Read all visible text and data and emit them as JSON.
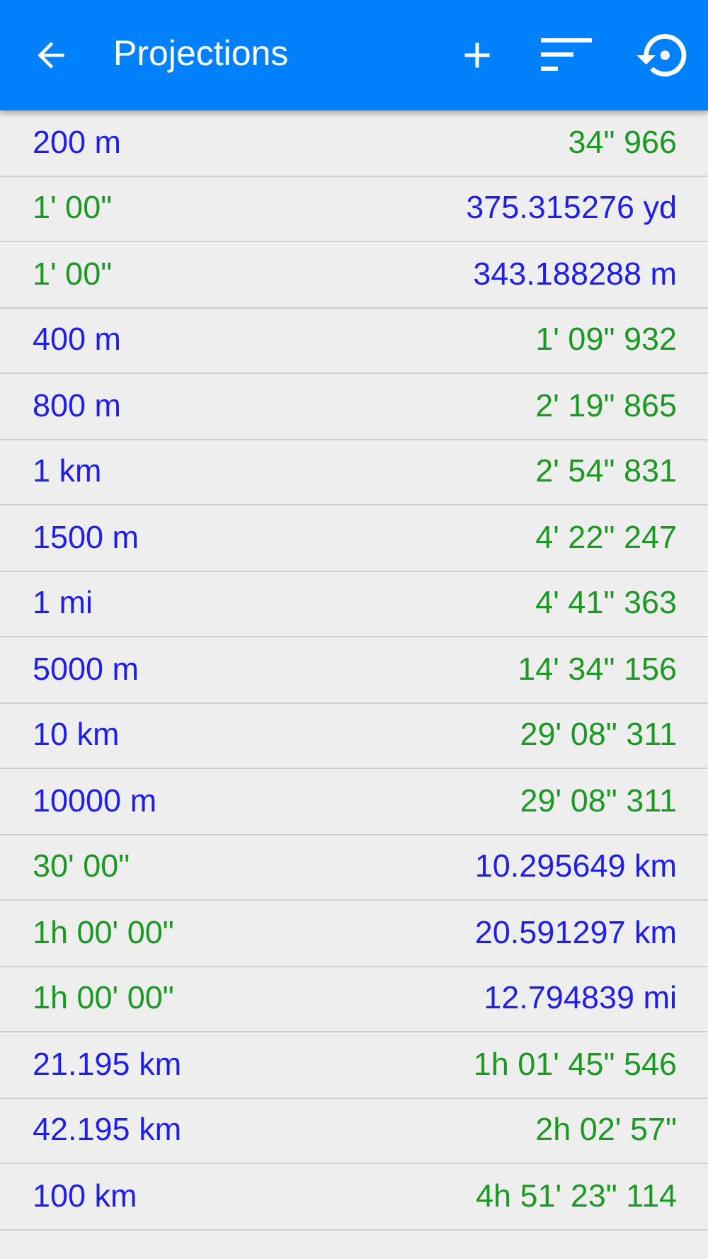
{
  "app_bar": {
    "title": "Projections"
  },
  "rows": [
    {
      "kind": "distance",
      "left": "200 m",
      "right": "34\" 966"
    },
    {
      "kind": "time",
      "left": "1' 00\"",
      "right": "375.315276 yd"
    },
    {
      "kind": "time",
      "left": "1' 00\"",
      "right": "343.188288 m"
    },
    {
      "kind": "distance",
      "left": "400 m",
      "right": "1' 09\" 932"
    },
    {
      "kind": "distance",
      "left": "800 m",
      "right": "2' 19\" 865"
    },
    {
      "kind": "distance",
      "left": "1 km",
      "right": "2' 54\" 831"
    },
    {
      "kind": "distance",
      "left": "1500 m",
      "right": "4' 22\" 247"
    },
    {
      "kind": "distance",
      "left": "1 mi",
      "right": "4' 41\" 363"
    },
    {
      "kind": "distance",
      "left": "5000 m",
      "right": "14' 34\" 156"
    },
    {
      "kind": "distance",
      "left": "10 km",
      "right": "29' 08\" 311"
    },
    {
      "kind": "distance",
      "left": "10000 m",
      "right": "29' 08\" 311"
    },
    {
      "kind": "time",
      "left": "30' 00\"",
      "right": "10.295649 km"
    },
    {
      "kind": "time",
      "left": "1h 00' 00\"",
      "right": "20.591297 km"
    },
    {
      "kind": "time",
      "left": "1h 00' 00\"",
      "right": "12.794839 mi"
    },
    {
      "kind": "distance",
      "left": "21.195 km",
      "right": "1h 01' 45\" 546"
    },
    {
      "kind": "distance",
      "left": "42.195 km",
      "right": "2h 02' 57\""
    },
    {
      "kind": "distance",
      "left": "100 km",
      "right": "4h 51' 23\" 114"
    }
  ]
}
